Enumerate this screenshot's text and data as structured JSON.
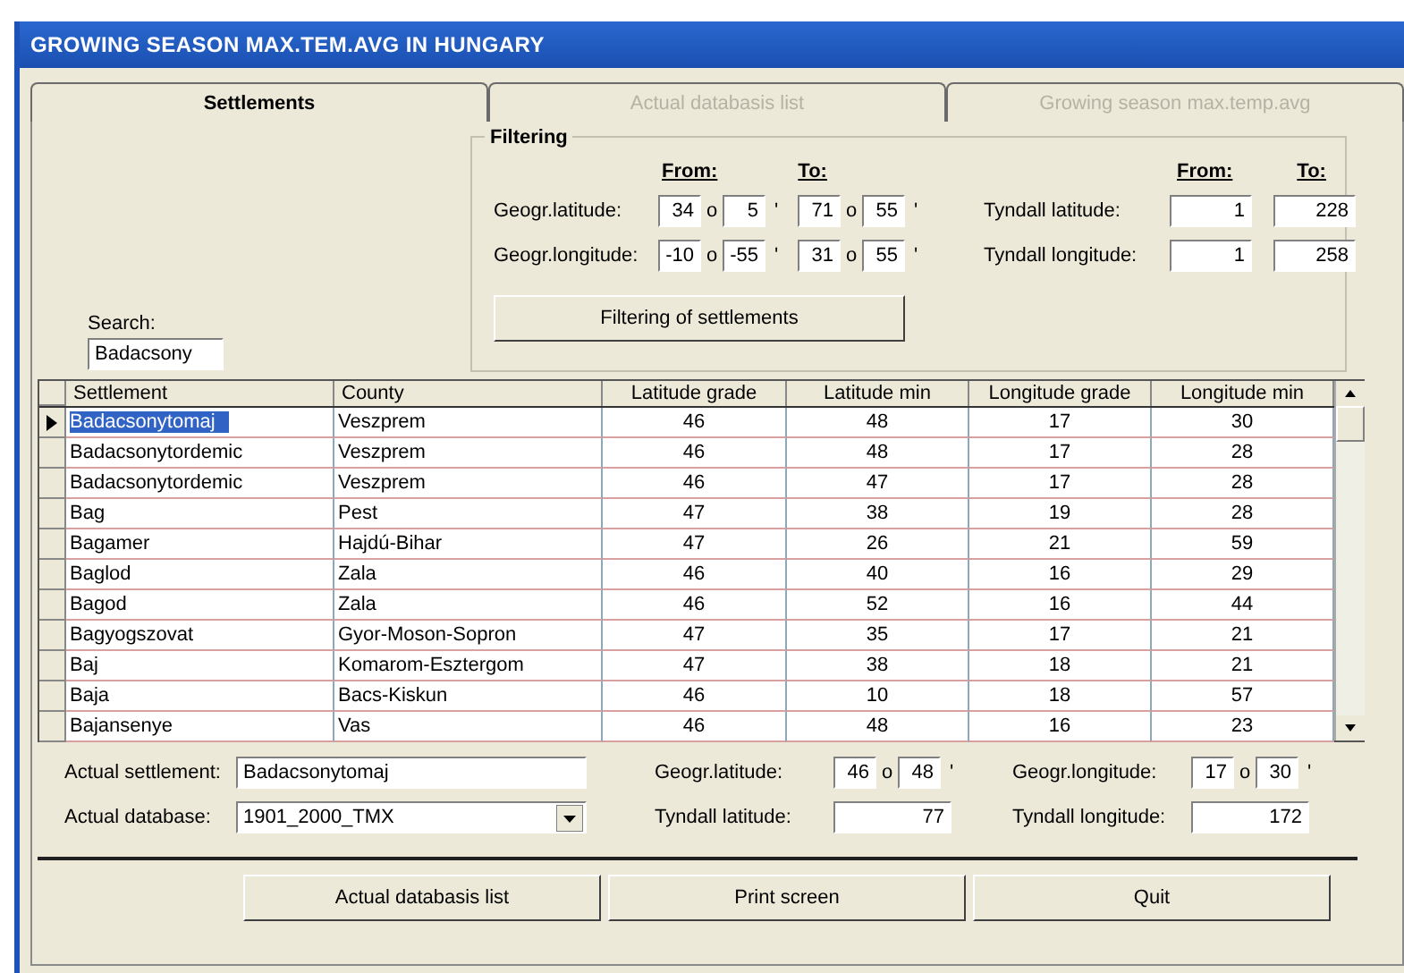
{
  "window": {
    "title": "GROWING SEASON MAX.TEM.AVG IN HUNGARY"
  },
  "tabs": [
    {
      "label": "Settlements",
      "selected": true
    },
    {
      "label": "Actual databasis list",
      "selected": false
    },
    {
      "label": "Growing season max.temp.avg",
      "selected": false
    }
  ],
  "search": {
    "label": "Search:",
    "value": "Badacsony"
  },
  "filtering": {
    "title": "Filtering",
    "geo_headers": {
      "from": "From:",
      "to": "To:"
    },
    "geo_rows": [
      {
        "label": "Geogr.latitude:",
        "from": {
          "deg": "34",
          "deg_sign": "o",
          "min": "5",
          "min_sign": "'"
        },
        "to": {
          "deg": "71",
          "deg_sign": "o",
          "min": "55",
          "min_sign": "'"
        }
      },
      {
        "label": "Geogr.longitude:",
        "from": {
          "deg": "-10",
          "deg_sign": "o",
          "min": "-55",
          "min_sign": "'"
        },
        "to": {
          "deg": "31",
          "deg_sign": "o",
          "min": "55",
          "min_sign": "'"
        }
      }
    ],
    "tyndall_headers": {
      "from": "From:",
      "to": "To:"
    },
    "tyndall_rows": [
      {
        "label": "Tyndall latitude:",
        "from": "1",
        "to": "228"
      },
      {
        "label": "Tyndall longitude:",
        "from": "1",
        "to": "258"
      }
    ],
    "button": "Filtering of settlements"
  },
  "table": {
    "columns": [
      "Settlement",
      "County",
      "Latitude grade",
      "Latitude min",
      "Longitude grade",
      "Longitude min"
    ],
    "rows": [
      {
        "selected": true,
        "cells": [
          "Badacsonytomaj",
          "Veszprem",
          "46",
          "48",
          "17",
          "30"
        ]
      },
      {
        "selected": false,
        "cells": [
          "Badacsonytordemic",
          "Veszprem",
          "46",
          "48",
          "17",
          "28"
        ]
      },
      {
        "selected": false,
        "cells": [
          "Badacsonytordemic",
          "Veszprem",
          "46",
          "47",
          "17",
          "28"
        ]
      },
      {
        "selected": false,
        "cells": [
          "Bag",
          "Pest",
          "47",
          "38",
          "19",
          "28"
        ]
      },
      {
        "selected": false,
        "cells": [
          "Bagamer",
          "Hajdú-Bihar",
          "47",
          "26",
          "21",
          "59"
        ]
      },
      {
        "selected": false,
        "cells": [
          "Baglod",
          "Zala",
          "46",
          "40",
          "16",
          "29"
        ]
      },
      {
        "selected": false,
        "cells": [
          "Bagod",
          "Zala",
          "46",
          "52",
          "16",
          "44"
        ]
      },
      {
        "selected": false,
        "cells": [
          "Bagyogszovat",
          "Gyor-Moson-Sopron",
          "47",
          "35",
          "17",
          "21"
        ]
      },
      {
        "selected": false,
        "cells": [
          "Baj",
          "Komarom-Esztergom",
          "47",
          "38",
          "18",
          "21"
        ]
      },
      {
        "selected": false,
        "cells": [
          "Baja",
          "Bacs-Kiskun",
          "46",
          "10",
          "18",
          "57"
        ]
      },
      {
        "selected": false,
        "cells": [
          "Bajansenye",
          "Vas",
          "46",
          "48",
          "16",
          "23"
        ]
      }
    ]
  },
  "actual": {
    "settlement": {
      "label": "Actual settlement:",
      "value": "Badacsonytomaj"
    },
    "database": {
      "label": "Actual database:",
      "value": "1901_2000_TMX"
    },
    "geo_latitude": {
      "label": "Geogr.latitude:",
      "deg": "46",
      "deg_sign": "o",
      "min": "48",
      "min_sign": "'"
    },
    "geo_longitude": {
      "label": "Geogr.longitude:",
      "deg": "17",
      "deg_sign": "o",
      "min": "30",
      "min_sign": "'"
    },
    "tyndall_latitude": {
      "label": "Tyndall latitude:",
      "value": "77"
    },
    "tyndall_longitude": {
      "label": "Tyndall longitude:",
      "value": "172"
    }
  },
  "buttons": [
    "Actual databasis list",
    "Print screen",
    "Quit"
  ]
}
